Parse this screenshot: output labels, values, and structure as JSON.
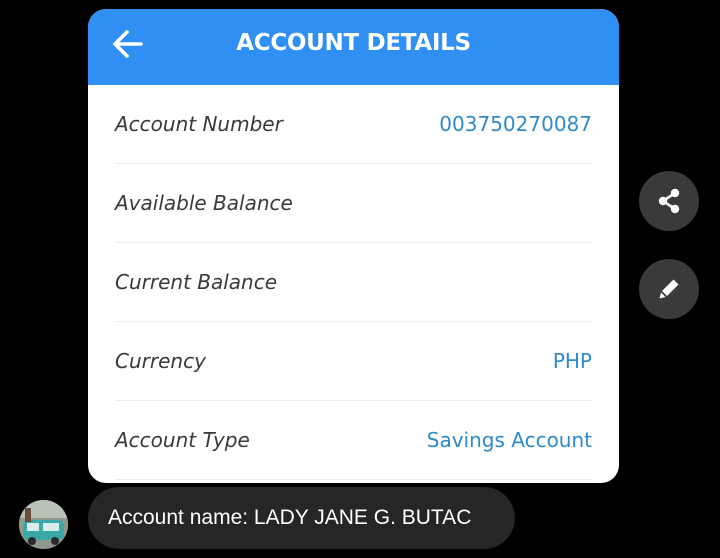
{
  "card": {
    "title": "ACCOUNT DETAILS",
    "back_icon": "arrow-left-icon",
    "header_color": "#2f8ff2",
    "rows": [
      {
        "label": "Account Number",
        "value": "003750270087"
      },
      {
        "label": "Available Balance",
        "value": ""
      },
      {
        "label": "Current Balance",
        "value": ""
      },
      {
        "label": "Currency",
        "value": "PHP"
      },
      {
        "label": "Account Type",
        "value": "Savings Account"
      }
    ]
  },
  "actions": {
    "share_icon": "share-icon",
    "edit_icon": "pencil-icon"
  },
  "message": {
    "text": "Account name: LADY JANE G. BUTAC"
  }
}
